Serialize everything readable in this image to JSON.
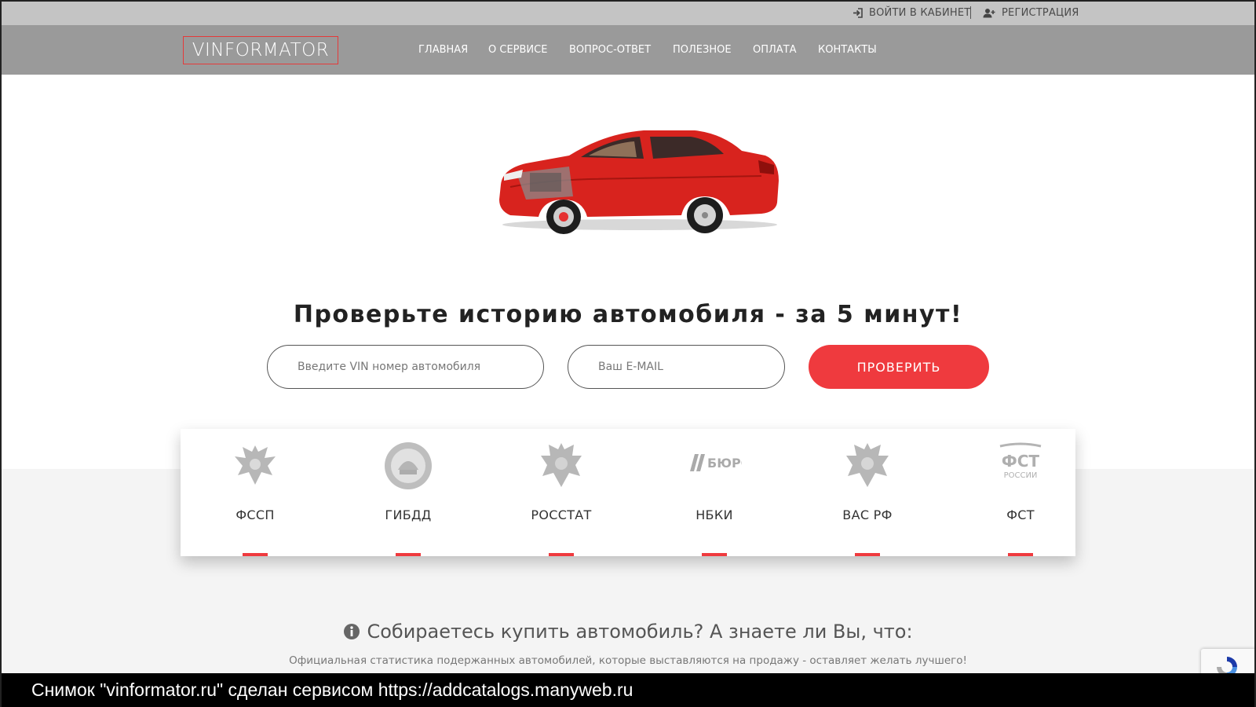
{
  "topbar": {
    "login_label": "ВОЙТИ В КАБИНЕТ",
    "register_label": "РЕГИСТРАЦИЯ"
  },
  "navbar": {
    "logo_text": "VINFORMATOR",
    "items": [
      {
        "label": "ГЛАВНАЯ"
      },
      {
        "label": "О СЕРВИСЕ"
      },
      {
        "label": "ВОПРОС-ОТВЕТ"
      },
      {
        "label": "ПОЛЕЗНОЕ"
      },
      {
        "label": "ОПЛАТА"
      },
      {
        "label": "КОНТАКТЫ"
      }
    ]
  },
  "hero": {
    "title": "Проверьте историю автомобиля - за 5 минут!",
    "vin_placeholder": "Введите VIN номер автомобиля",
    "email_placeholder": "Ваш E-MAIL",
    "submit_label": "ПРОВЕРИТЬ"
  },
  "sources": [
    {
      "name": "ФССП",
      "icon": "eagle-emblem-icon"
    },
    {
      "name": "ГИБДД",
      "icon": "gibdd-emblem-icon"
    },
    {
      "name": "РОССТАТ",
      "icon": "eagle-emblem-icon"
    },
    {
      "name": "НБКИ",
      "icon": "bureau-logo-icon",
      "logo_text": "БЮРО"
    },
    {
      "name": "ВАС РФ",
      "icon": "eagle-emblem-icon"
    },
    {
      "name": "ФСТ",
      "icon": "fst-logo-icon",
      "logo_text": "ФСТ",
      "logo_subtext": "РОССИИ"
    }
  ],
  "info": {
    "title": "Собираетесь купить автомобиль? А знаете ли Вы, что:",
    "subtitle": "Официальная статистика подержанных автомобилей, которые выставляются на продажу - оставляет желать лучшего!"
  },
  "footer_banner": {
    "text": "Снимок \"vinformator.ru\" сделан сервисом https://addcatalogs.manyweb.ru"
  },
  "colors": {
    "accent": "#ef3a3e",
    "topbar": "#c4c4c4",
    "navbar": "#9a9a9a",
    "section_bg": "#f4f4f4"
  }
}
